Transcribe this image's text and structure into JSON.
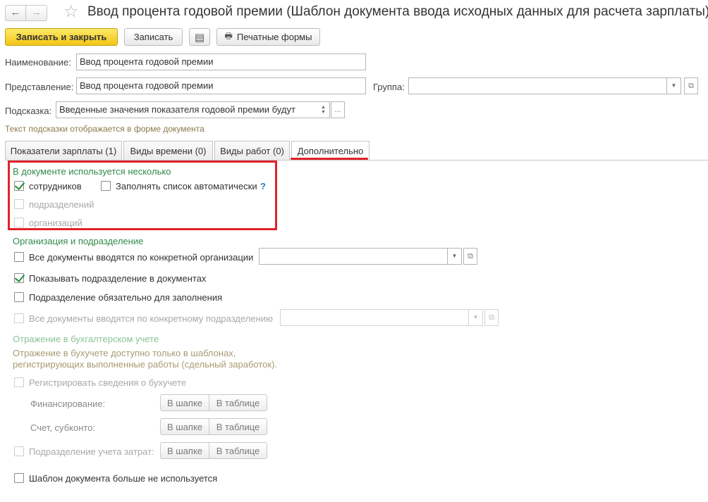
{
  "window": {
    "title": "Ввод процента годовой премии (Шаблон документа ввода исходных данных для расчета зарплаты)",
    "back_icon": "←",
    "forward_icon": "→",
    "star_icon": "☆"
  },
  "toolbar": {
    "save_close_label": "Записать и закрыть",
    "save_label": "Записать",
    "list_icon": "▤",
    "print_icon": "🖶",
    "print_forms_label": "Печатные формы"
  },
  "form": {
    "name_label": "Наименование:",
    "name_value": "Ввод процента годовой премии",
    "presentation_label": "Представление:",
    "presentation_value": "Ввод процента годовой премии",
    "group_label": "Группа:",
    "group_value": "",
    "hint_label": "Подсказка:",
    "hint_value": "Введенные значения показателя годовой премии будут",
    "hint_note": "Текст подсказки отображается в форме документа",
    "dropdown_icon": "▼",
    "open_icon": "⧉",
    "ellipsis": "...",
    "spin_icon": "▲▼"
  },
  "tabs": [
    {
      "label": "Показатели зарплаты (1)"
    },
    {
      "label": "Виды времени (0)"
    },
    {
      "label": "Виды работ (0)"
    },
    {
      "label": "Дополнительно"
    }
  ],
  "multi_section": {
    "header": "В документе используется несколько",
    "employees": {
      "label": "сотрудников",
      "checked": true
    },
    "autofill": {
      "label": "Заполнять список автоматически",
      "checked": false
    },
    "help": "?",
    "departments": {
      "label": "подразделений",
      "checked": false
    },
    "organizations": {
      "label": "организаций",
      "checked": false
    }
  },
  "org_section": {
    "header": "Организация и подразделение",
    "all_by_org": {
      "label": "Все документы вводятся по конкретной организации",
      "checked": false
    },
    "show_department": {
      "label": "Показывать подразделение в документах",
      "checked": true
    },
    "department_required": {
      "label": "Подразделение обязательно для заполнения",
      "checked": false
    },
    "all_by_department": {
      "label": "Все документы вводятся по конкретному подразделению",
      "checked": false
    }
  },
  "accounting_section": {
    "header": "Отражение в бухгалтерском учете",
    "note_line1": "Отражение в бухучете доступно только в шаблонах,",
    "note_line2": "регистрирующих выполненные работы (сдельный заработок).",
    "register": {
      "label": "Регистрировать сведения о бухучете",
      "checked": false
    },
    "financing_label": "Финансирование:",
    "account_label": "Счет, субконто:",
    "cost_dept_label": "Подразделение учета затрат:",
    "in_header": "В шапке",
    "in_table": "В таблице"
  },
  "template_unused": {
    "label": "Шаблон документа больше не используется",
    "checked": false
  }
}
